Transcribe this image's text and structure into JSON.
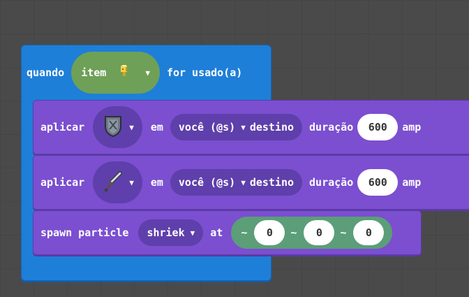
{
  "event": {
    "when_label": "quando",
    "item_label": "item",
    "item_icon": "yellow-item-icon",
    "used_label": "for usado(a)"
  },
  "commands": [
    {
      "apply_label": "aplicar",
      "effect_icon": "shield-icon",
      "in_label": "em",
      "target_value": "você (@s)",
      "destination_label": "destino",
      "duration_label": "duração",
      "duration_value": "600",
      "amp_label": "amp"
    },
    {
      "apply_label": "aplicar",
      "effect_icon": "sword-icon",
      "in_label": "em",
      "target_value": "você (@s)",
      "destination_label": "destino",
      "duration_label": "duração",
      "duration_value": "600",
      "amp_label": "amp"
    }
  ],
  "particle": {
    "label": "spawn particle",
    "type_value": "shriek",
    "at_label": "at",
    "tilde": "~",
    "x": "0",
    "y": "0",
    "z": "0"
  },
  "colors": {
    "background": "#4a4a4a",
    "event_block": "#1e7fd8",
    "command_block": "#7b4fd0",
    "item_pill": "#6fa057",
    "vector_pill": "#5c9e78"
  }
}
